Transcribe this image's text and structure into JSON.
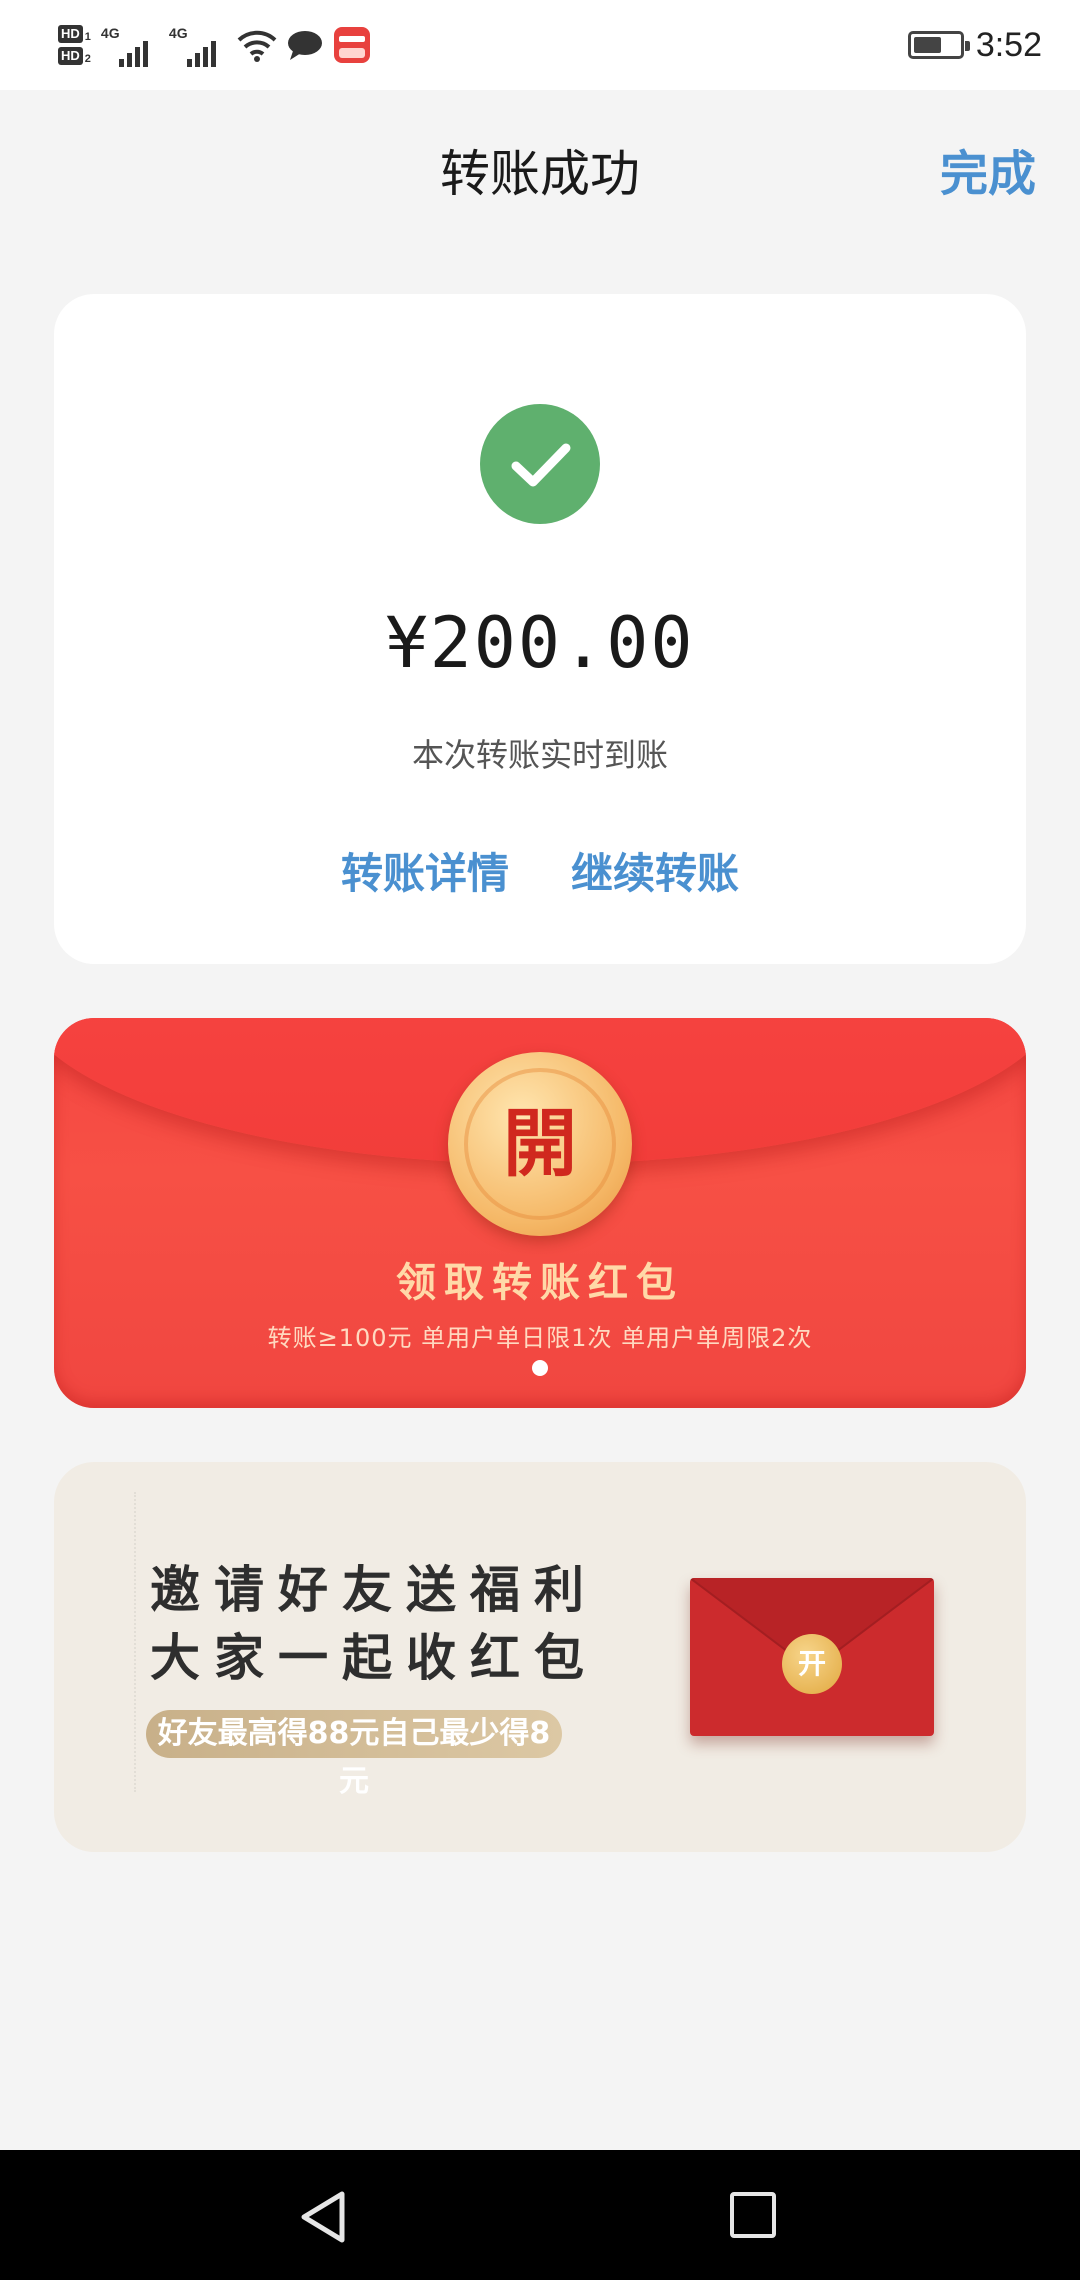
{
  "status_bar": {
    "sim1": "HD",
    "sim1_index": "1",
    "sim2": "HD",
    "sim2_index": "2",
    "network1": "4G",
    "network2": "4G",
    "time": "3:52",
    "battery_level": 0.62,
    "icons": [
      "signal-icon",
      "wifi-icon",
      "chat-icon",
      "app-notification-icon",
      "battery-icon"
    ]
  },
  "header": {
    "title": "转账成功",
    "done_label": "完成"
  },
  "result": {
    "status_icon": "check-icon",
    "amount": "¥200.00",
    "arrival_note": "本次转账实时到账",
    "details_link": "转账详情",
    "continue_link": "继续转账"
  },
  "red_packet": {
    "coin_char": "開",
    "title": "领取转账红包",
    "rule": "转账≥100元  单用户单日限1次  单用户单周限2次",
    "page_dots": 1,
    "active_dot": 0
  },
  "invite_banner": {
    "line1": "邀请好友送福利",
    "line2": "大家一起收红包",
    "badge": "好友最高得88元自己最少得8元",
    "envelope_seal": "开"
  },
  "nav_bar": {
    "icons": [
      "back-triangle-icon",
      "recents-square-icon"
    ]
  },
  "colors": {
    "accent_blue": "#4a90d0",
    "success_green": "#5fb06e",
    "red_packet": "#f44642"
  }
}
